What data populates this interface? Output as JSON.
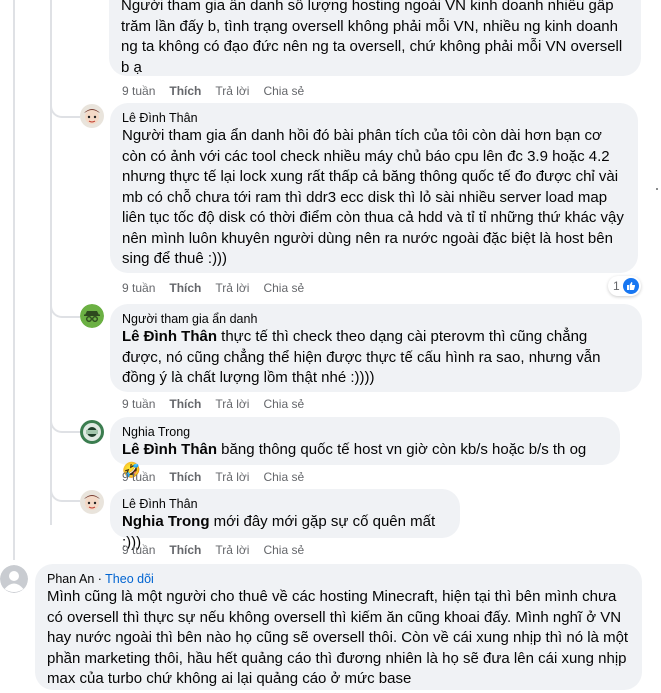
{
  "comments": [
    {
      "text": "Người tham gia ẩn danh số lượng hosting ngoài VN kinh doanh nhiều gấp trăm lần đấy b, tình trạng oversell không phải mỗi VN, nhiều ng kinh doanh ng ta không có đạo đức nên ng ta oversell, chứ không phải mỗi VN oversell b ạ",
      "time": "9 tuần",
      "like": "Thích",
      "reply": "Trả lời",
      "share": "Chia sẻ"
    },
    {
      "author": "Lê Đình Thân",
      "text": "Người tham gia ẩn danh hồi đó bài phân tích của tôi còn dài hơn bạn cơ còn có ảnh với các tool check nhiều máy chủ báo cpu lên đc 3.9 hoặc 4.2 nhưng thực tế lại lock xung rất thấp cả băng thông quốc tế đo được chỉ vài mb có chỗ chưa tới ram thì ddr3 ecc disk thì lỏ sài nhiều server load map liên tục tốc độ disk có thời điểm còn thua cả hdd và tỉ tỉ những thứ khác vậy nên mình luôn khuyên người dùng nên ra nước ngoài đặc biệt là host bên sing để thuê :)))",
      "time": "9 tuần",
      "like": "Thích",
      "reply": "Trả lời",
      "share": "Chia sẻ",
      "reaction_count": "1",
      "reaction_icon": "like-icon"
    },
    {
      "author": "Người tham gia ẩn danh",
      "mention": "Lê Đình Thân",
      "text": " thực tế thì check theo dạng cài pterovm thì cũng chẳng được, nó cũng chẳng thể hiện được thực tế cấu hình ra sao, nhưng vẫn đồng ý là chất lượng lồm thật nhé :))))",
      "time": "9 tuần",
      "like": "Thích",
      "reply": "Trả lời",
      "share": "Chia sẻ"
    },
    {
      "author": "Nghia Trong",
      "mention": "Lê Đình Thân",
      "text": " băng thông quốc tế host vn giờ còn kb/s hoặc b/s th og 🤣",
      "time": "9 tuần",
      "like": "Thích",
      "reply": "Trả lời",
      "share": "Chia sẻ"
    },
    {
      "author": "Lê Đình Thân",
      "mention": "Nghia Trong",
      "text": " mới đây mới gặp sự cố quên mất :)))",
      "time": "9 tuần",
      "like": "Thích",
      "reply": "Trả lời",
      "share": "Chia sẻ"
    },
    {
      "author": "Phan An",
      "separator": " · ",
      "follow": "Theo dõi",
      "text": "Mình cũng là một người cho thuê về các hosting Minecraft, hiện tại thì bên mình chưa có oversell thì thực sự nếu không oversell thì kiếm ăn cũng khoai đấy. Mình nghĩ ở VN hay nước ngoài thì bên nào họ cũng sẽ oversell thôi. Còn về cái xung nhịp thì nó là một phần marketing thôi, hầu hết quảng cáo thì đương nhiên là họ sẽ đưa lên cái xung nhịp max của turbo chứ không ai lại quảng cáo ở mức base"
    }
  ],
  "colors": {
    "bubble": "#f0f2f5",
    "link": "#0064d1",
    "meta": "#65676b",
    "like_badge": "#1877f2"
  }
}
